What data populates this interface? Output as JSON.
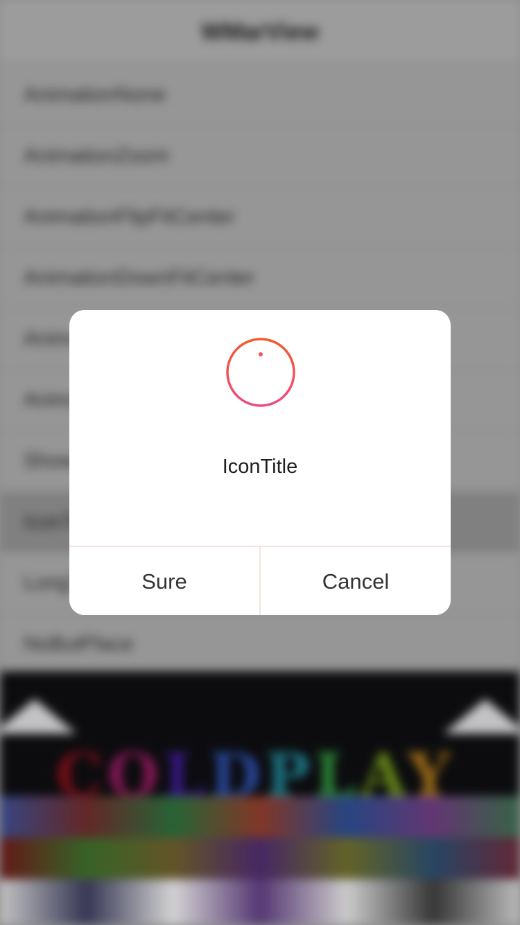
{
  "background": {
    "nav_title": "WMarView",
    "list_items": [
      {
        "label": "AnimationNone"
      },
      {
        "label": "AnimationZoom"
      },
      {
        "label": "AnimationFlipFitCenter"
      },
      {
        "label": "AnimationDownFitCenter"
      },
      {
        "label": "AnimationFade"
      },
      {
        "label": "AnimationScale"
      },
      {
        "label": "ShowMore"
      },
      {
        "label": "IconTitle"
      },
      {
        "label": "LongTitle"
      },
      {
        "label": "NoButPlace"
      }
    ],
    "poster_text": "COLDPLAY"
  },
  "alert": {
    "icon": "info-circle-icon",
    "title": "IconTitle",
    "buttons": [
      {
        "label": "Sure"
      },
      {
        "label": "Cancel"
      }
    ]
  },
  "colors": {
    "icon_gradient_top": "#f25a2a",
    "icon_gradient_bottom": "#ee4a86",
    "divider": "#f3e3df"
  }
}
